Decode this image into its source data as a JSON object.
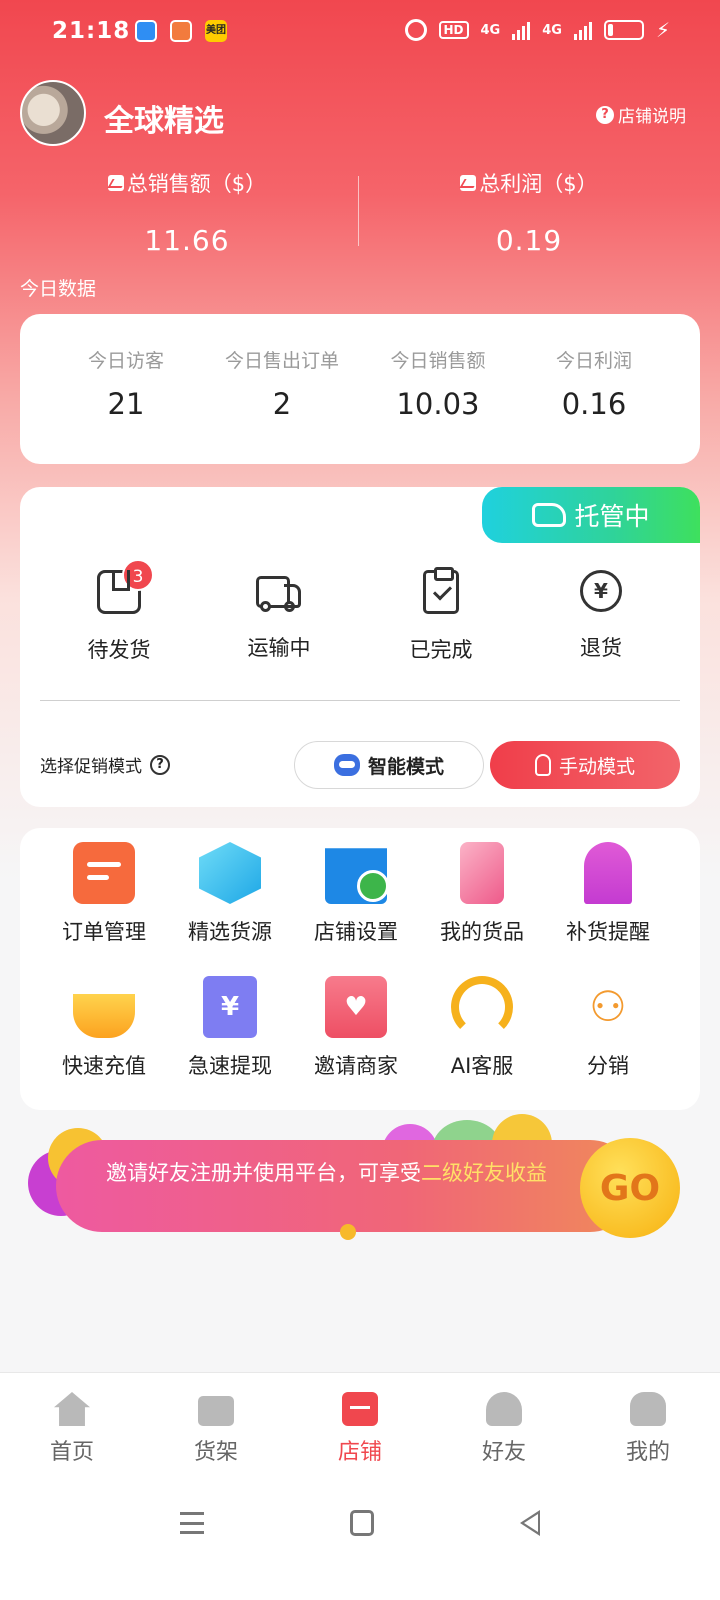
{
  "status_bar": {
    "time": "21:18",
    "app_badge_text": "美团",
    "network_hd": "HD",
    "network_1": "4G",
    "network_2": "4G"
  },
  "header": {
    "store_name": "全球精选",
    "help_label": "店铺说明",
    "help_icon": "?"
  },
  "summary": [
    {
      "label": "总销售额（$）",
      "value": "11.66"
    },
    {
      "label": "总利润（$）",
      "value": "0.19"
    }
  ],
  "today": {
    "title": "今日数据",
    "stats": [
      {
        "label": "今日访客",
        "value": "21"
      },
      {
        "label": "今日售出订单",
        "value": "2"
      },
      {
        "label": "今日销售额",
        "value": "10.03"
      },
      {
        "label": "今日利润",
        "value": "0.16"
      }
    ]
  },
  "orders": {
    "managed_label": "托管中",
    "items": [
      {
        "label": "待发货",
        "badge": "3",
        "icon": "package-icon"
      },
      {
        "label": "运输中",
        "icon": "truck-icon"
      },
      {
        "label": "已完成",
        "icon": "clipboard-check-icon"
      },
      {
        "label": "退货",
        "icon": "yen-refund-icon"
      }
    ],
    "promo_label": "选择促销模式",
    "smart_mode": "智能模式",
    "manual_mode": "手动模式",
    "yen_symbol": "¥"
  },
  "menu": {
    "items": [
      {
        "label": "订单管理",
        "icon": "order-manage-icon"
      },
      {
        "label": "精选货源",
        "icon": "box-source-icon"
      },
      {
        "label": "店铺设置",
        "icon": "store-settings-icon"
      },
      {
        "label": "我的货品",
        "icon": "cart-goods-icon"
      },
      {
        "label": "补货提醒",
        "icon": "bell-reminder-icon"
      },
      {
        "label": "快速充值",
        "icon": "topup-icon"
      },
      {
        "label": "急速提现",
        "icon": "withdraw-icon"
      },
      {
        "label": "邀请商家",
        "icon": "invite-envelope-icon"
      },
      {
        "label": "AI客服",
        "icon": "headset-icon"
      },
      {
        "label": "分销",
        "icon": "distribution-icon"
      }
    ],
    "withdraw_glyph": "¥",
    "invite_glyph": "♥",
    "dist_glyph": "⚇"
  },
  "invite_banner": {
    "text": "邀请好友注册并使用平台，可享受",
    "highlight": "二级好友收益",
    "go_label": "GO"
  },
  "tabbar": {
    "tabs": [
      {
        "label": "首页",
        "icon": "home-icon"
      },
      {
        "label": "货架",
        "icon": "shelf-bag-icon"
      },
      {
        "label": "店铺",
        "icon": "store-icon",
        "active": true
      },
      {
        "label": "好友",
        "icon": "friends-icon"
      },
      {
        "label": "我的",
        "icon": "profile-icon"
      }
    ]
  },
  "colors": {
    "brand_red": "#f0474e",
    "managed_green": "#2fd39a",
    "highlight_yellow": "#ffe067"
  }
}
